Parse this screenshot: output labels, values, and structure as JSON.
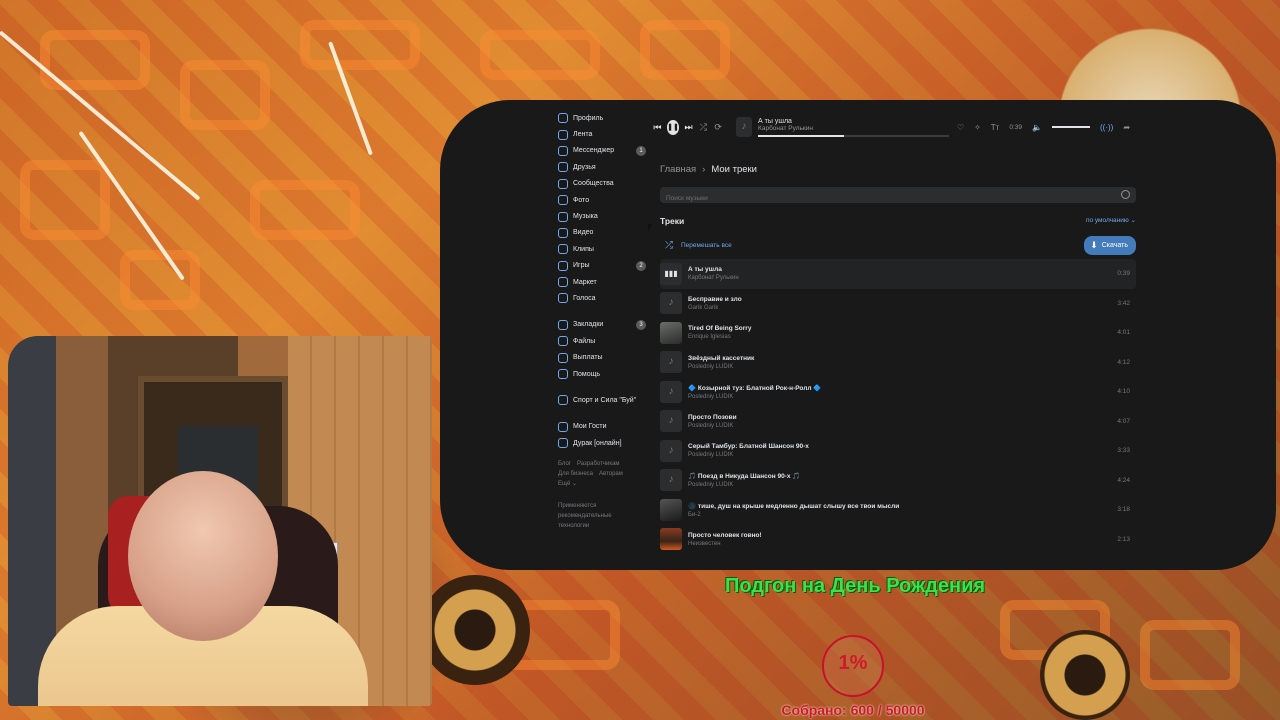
{
  "sidebar": {
    "items": [
      {
        "label": "Профиль",
        "icon": "user-icon"
      },
      {
        "label": "Лента",
        "icon": "news-icon"
      },
      {
        "label": "Мессенджер",
        "icon": "message-icon",
        "badge": "1"
      },
      {
        "label": "Друзья",
        "icon": "friends-icon"
      },
      {
        "label": "Сообщества",
        "icon": "groups-icon"
      },
      {
        "label": "Фото",
        "icon": "photo-icon"
      },
      {
        "label": "Музыка",
        "icon": "music-icon"
      },
      {
        "label": "Видео",
        "icon": "video-icon"
      },
      {
        "label": "Клипы",
        "icon": "clips-icon"
      },
      {
        "label": "Игры",
        "icon": "games-icon",
        "badge": "2"
      },
      {
        "label": "Маркет",
        "icon": "market-icon"
      },
      {
        "label": "Голоса",
        "icon": "votes-icon"
      }
    ],
    "secondary": [
      {
        "label": "Закладки",
        "icon": "bookmark-icon",
        "badge": "3"
      },
      {
        "label": "Файлы",
        "icon": "files-icon"
      },
      {
        "label": "Выплаты",
        "icon": "payments-icon"
      },
      {
        "label": "Помощь",
        "icon": "help-icon"
      }
    ],
    "communities": [
      {
        "label": "Спорт и Сила \"Буй\"",
        "icon": "community-icon"
      }
    ],
    "apps": [
      {
        "label": "Мои Гости",
        "icon": "app-icon"
      },
      {
        "label": "Дурак [онлайн]",
        "icon": "app-icon"
      }
    ],
    "footer_links": [
      "Блог",
      "Разработчикам",
      "Для бизнеса",
      "Авторам",
      "Ещё ⌄"
    ],
    "footer_note": "Применяются рекомендательные технологии"
  },
  "player": {
    "title": "А ты ушла",
    "artist": "Карбонат Рулькин",
    "time": "0:39",
    "progress": 0.45
  },
  "content": {
    "breadcrumb_home": "Главная",
    "breadcrumb_current": "Мои треки",
    "search_placeholder": "Поиск музыки",
    "tracks_title": "Треки",
    "sort_label": "по умолчанию ⌄",
    "shuffle_label": "Перемешать все",
    "download_label": "Скачать"
  },
  "tracks": [
    {
      "title": "А ты ушла",
      "artist": "Карбонат Рулькин",
      "duration": "0:39",
      "active": true
    },
    {
      "title": "Бесправие и зло",
      "artist": "Garik Garik",
      "duration": "3:42"
    },
    {
      "title": "Tired Of Being Sorry",
      "artist": "Enrique Iglesias",
      "duration": "4:01",
      "cover": "pic1"
    },
    {
      "title": "Звёздный кассетник",
      "artist": "Posledniy LUDIK",
      "duration": "4:12"
    },
    {
      "title": "🔷 Козырной туз: Блатной Рок-н-Ролл 🔷",
      "artist": "Posledniy LUDIK",
      "duration": "4:10"
    },
    {
      "title": "Просто Позови",
      "artist": "Posledniy LUDIK",
      "duration": "4:07"
    },
    {
      "title": "Серый Тамбур: Блатной Шансон 90-х",
      "artist": "Posledniy LUDIK",
      "duration": "3:33"
    },
    {
      "title": "🎵 Поезд в Никуда Шансон 90-х 🎵",
      "artist": "Posledniy LUDIK",
      "duration": "4:24"
    },
    {
      "title": "🌑 тише, душ на крыше медленно дышат слышу все твои мысли",
      "artist": "Би-2",
      "duration": "3:18",
      "cover": "pic2"
    },
    {
      "title": "Просто человек говно!",
      "artist": "Неизвестен",
      "duration": "2:13",
      "cover": "pic3"
    }
  ],
  "overlay": {
    "goal_title": "Подгон на День Рождения",
    "percent": "1%",
    "collected": "Собрано: 600 / 50000"
  },
  "colors": {
    "accent": "#71aaeb",
    "goal_green": "#3ee04a",
    "goal_red": "#d01a2a"
  }
}
